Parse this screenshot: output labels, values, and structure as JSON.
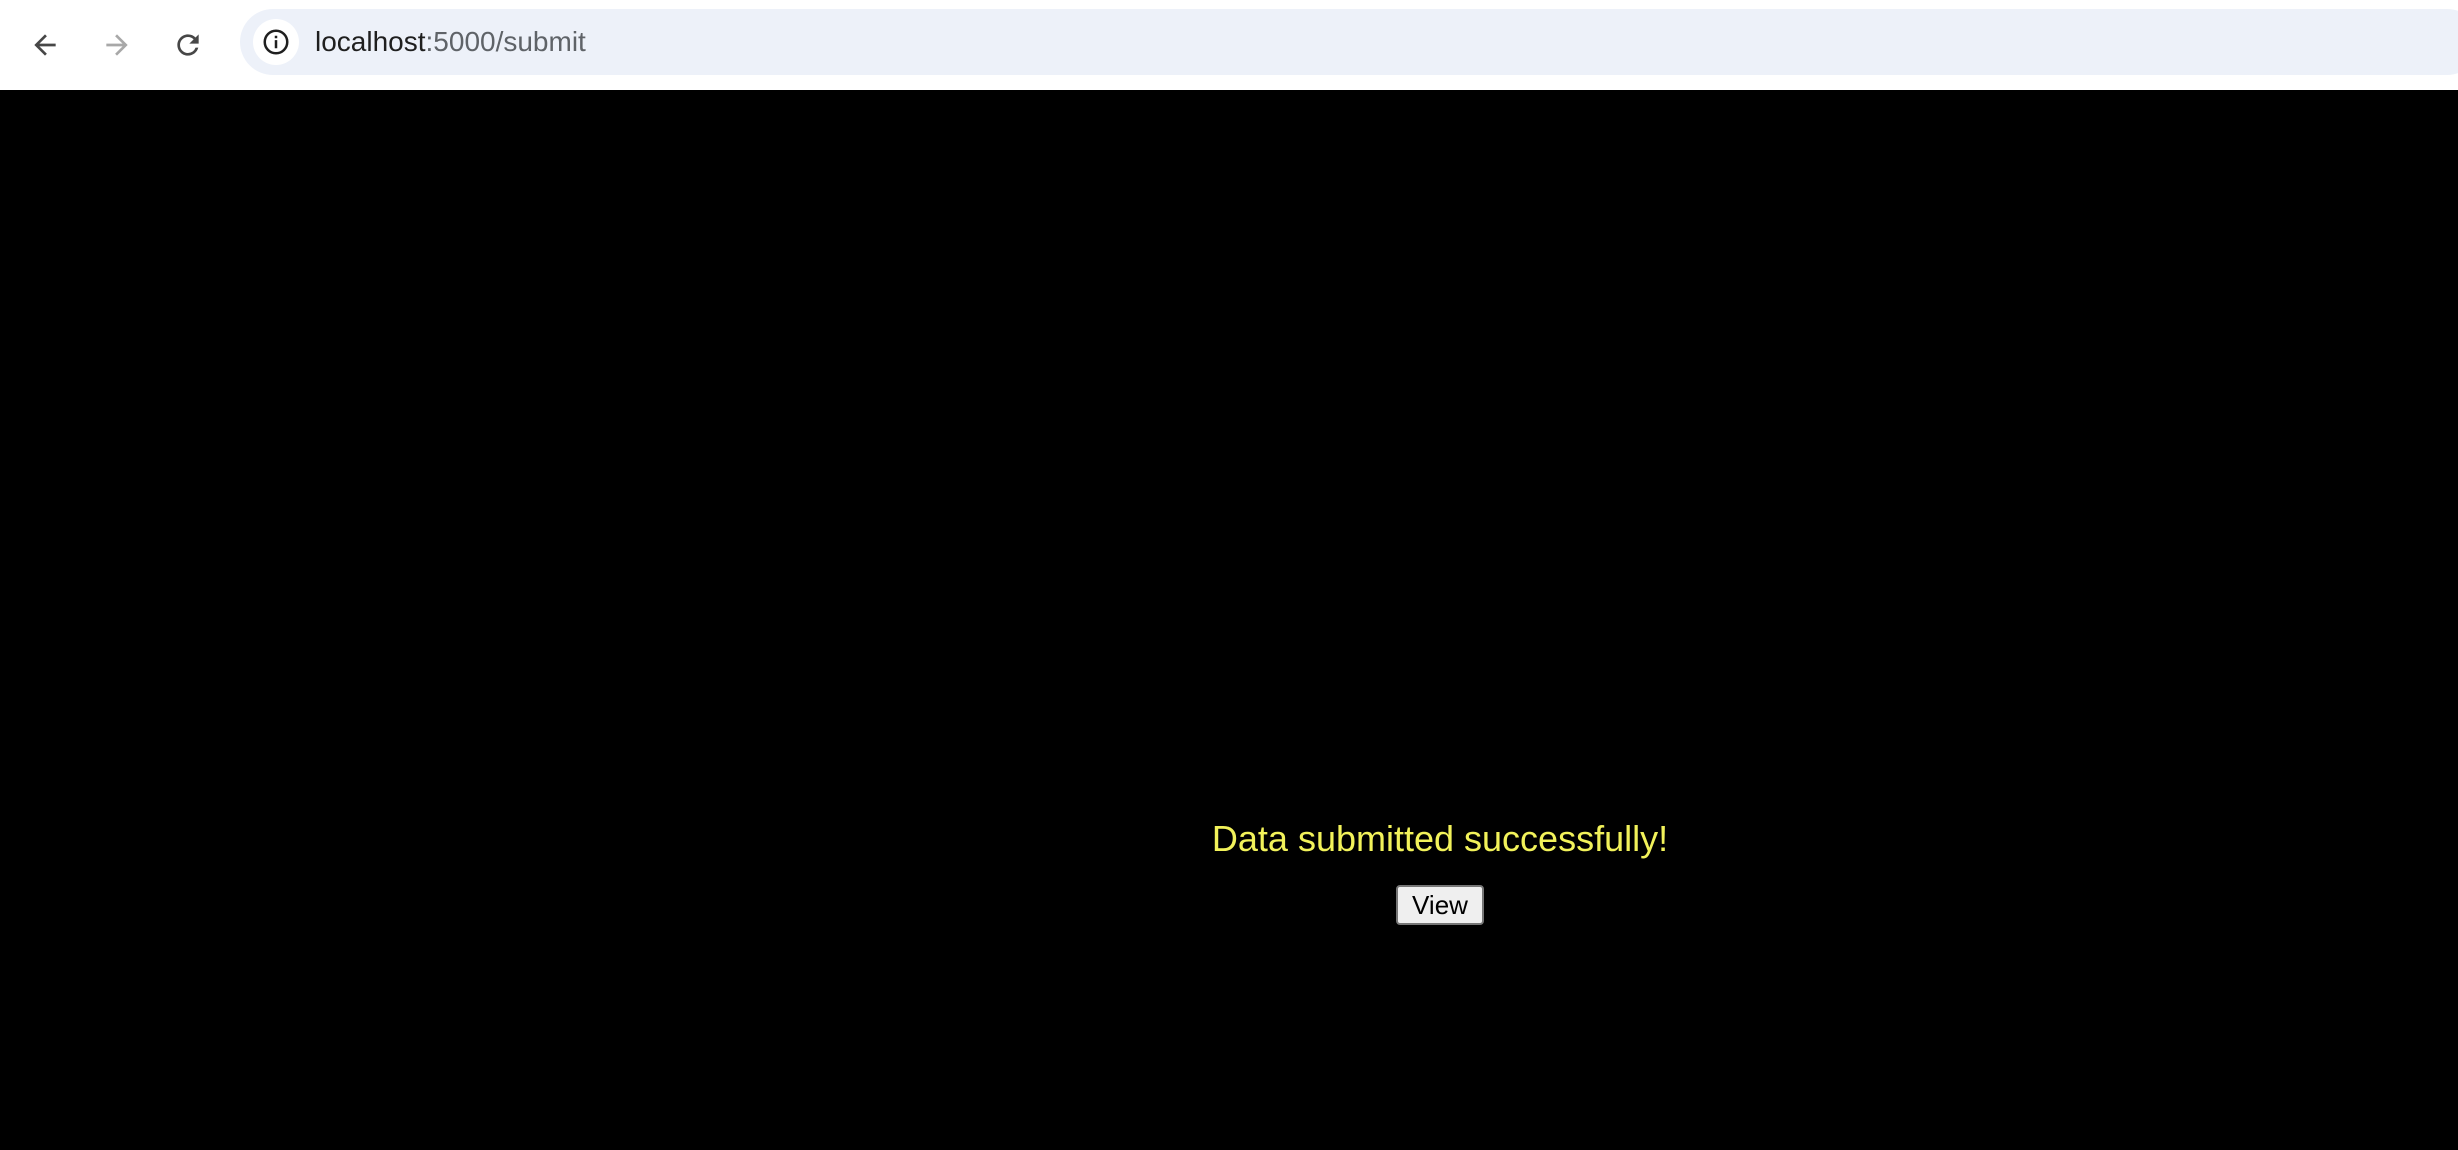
{
  "browser": {
    "url_host": "localhost",
    "url_rest": ":5000/submit"
  },
  "icons": {
    "back": "arrow-back-icon",
    "forward": "arrow-forward-icon",
    "reload": "reload-icon",
    "site_info": "info-icon"
  },
  "page": {
    "message": "Data submitted successfully!",
    "view_button_label": "View"
  },
  "colors": {
    "page_background": "#000000",
    "message_text": "#f2f25a",
    "omnibox_background": "#edf1f9"
  }
}
